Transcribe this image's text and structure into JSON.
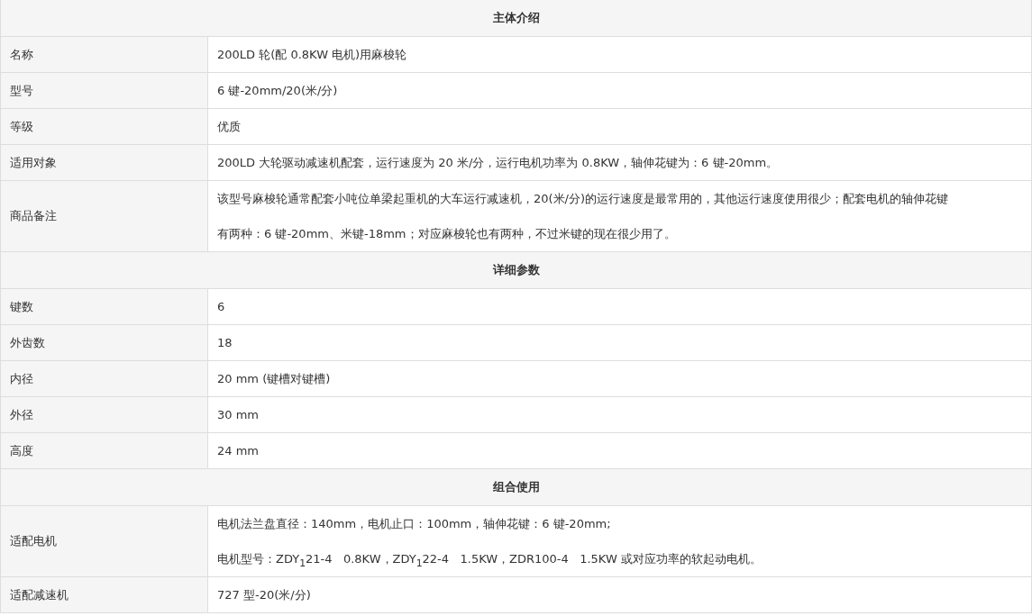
{
  "sections": [
    {
      "title": "主体介绍",
      "rows": [
        {
          "label": "名称",
          "lines": [
            "200LD 轮(配 0.8KW 电机)用麻梭轮"
          ]
        },
        {
          "label": "型号",
          "lines": [
            "6 键-20mm/20(米/分)"
          ]
        },
        {
          "label": "等级",
          "lines": [
            "优质"
          ]
        },
        {
          "label": "适用对象",
          "lines": [
            "200LD 大轮驱动减速机配套，运行速度为 20 米/分，运行电机功率为 0.8KW，轴伸花键为：6 键-20mm。"
          ]
        },
        {
          "label": "商品备注",
          "lines": [
            "该型号麻梭轮通常配套小吨位单梁起重机的大车运行减速机，20(米/分)的运行速度是最常用的，其他运行速度使用很少；配套电机的轴伸花键",
            "有两种：6 键-20mm、米键-18mm；对应麻梭轮也有两种，不过米键的现在很少用了。"
          ]
        }
      ]
    },
    {
      "title": "详细参数",
      "rows": [
        {
          "label": "键数",
          "lines": [
            "6"
          ]
        },
        {
          "label": "外齿数",
          "lines": [
            "18"
          ]
        },
        {
          "label": "内径",
          "lines": [
            "20 mm (键槽对键槽)"
          ]
        },
        {
          "label": "外径",
          "lines": [
            "30 mm"
          ]
        },
        {
          "label": "高度",
          "lines": [
            "24 mm"
          ]
        }
      ]
    },
    {
      "title": "组合使用",
      "rows": [
        {
          "label": "适配电机",
          "lines": [
            "电机法兰盘直径：140mm，电机止口：100mm，轴伸花键：6 键-20mm;",
            "电机型号：ZDY$_{1}$21-4   0.8KW，ZDY$_{1}$22-4   1.5KW，ZDR100-4   1.5KW 或对应功率的软起动电机。"
          ]
        },
        {
          "label": "适配减速机",
          "lines": [
            "727 型-20(米/分)"
          ]
        }
      ]
    }
  ]
}
